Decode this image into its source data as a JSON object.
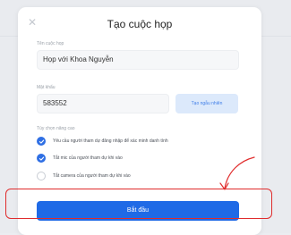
{
  "dialog": {
    "title": "Tạo cuộc họp",
    "meeting_name": {
      "label": "Tên cuộc họp",
      "value": "Họp với Khoa Nguyễn"
    },
    "password": {
      "label": "Mật khẩu",
      "value": "583552",
      "random_label": "Tạo ngẫu nhiên"
    },
    "advanced": {
      "label": "Tùy chọn nâng cao",
      "options": [
        {
          "text": "Yêu cầu người tham dự đăng nhập để xác minh danh tính",
          "checked": true
        },
        {
          "text": "Tắt mic của người tham dự khi vào",
          "checked": true
        },
        {
          "text": "Tắt camera của người tham dự khi vào",
          "checked": false
        }
      ]
    },
    "start_label": "Bắt đầu"
  },
  "colors": {
    "accent": "#1f6ae6",
    "annotation": "#e02c2c"
  }
}
